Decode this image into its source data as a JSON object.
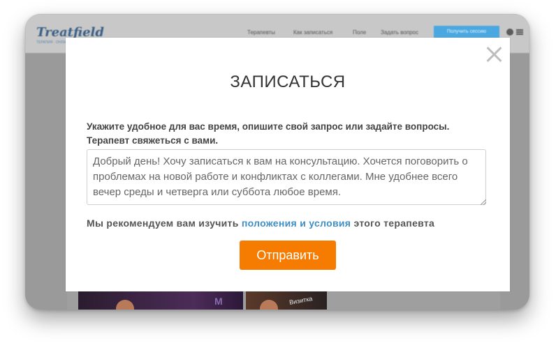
{
  "site": {
    "logo_text": "Treatfield",
    "logo_subtitle": "ТЕРАПИЯ · ОНЛАЙН",
    "nav_items": [
      {
        "label": "Терапевты"
      },
      {
        "label": "Как записаться"
      },
      {
        "label": "Поле"
      },
      {
        "label": "Задать вопрос"
      }
    ],
    "nav_cta": "Получить сессию"
  },
  "modal": {
    "title": "ЗАПИСАТЬСЯ",
    "instruction": "Укажите удобное для вас время, опишите свой запрос или задайте вопросы. Терапевт свяжеться с вами.",
    "message_value": "Добрый день! Хочу записаться к вам на консультацию. Хочется поговорить о проблемах на новой работе и конфликтах с коллегами. Мне удобнее всего вечер среды и четверга или суббота любое время.",
    "terms_prefix": "Мы рекомендуем вам изучить",
    "terms_link": "положения и условия",
    "terms_suffix": "этого терапевта",
    "submit_label": "Отправить"
  },
  "background": {
    "video_thumb_label": "Визитка"
  },
  "colors": {
    "accent_orange": "#f57c00",
    "link_blue": "#3f8ec6",
    "nav_button_blue": "#4aa7e0"
  }
}
